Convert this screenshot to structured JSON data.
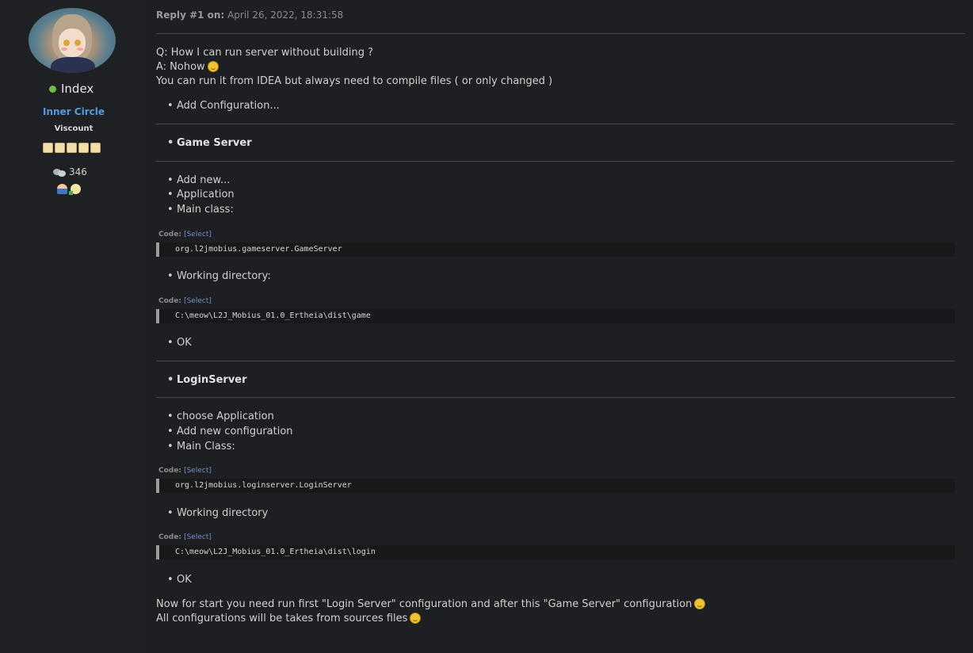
{
  "poster": {
    "username": "Index",
    "group": "Inner Circle",
    "rank": "Viscount",
    "posts": "346",
    "colors": {
      "group": "#4f9de0",
      "online": "#6cbf3f"
    }
  },
  "post": {
    "reply_label": "Reply #1 on:",
    "date": "April 26, 2022, 18:31:58",
    "intro": [
      "Q: How I can run server without building ?",
      "A: Nohow",
      "You can run it from IDEA but always need to compile files ( or only changed )"
    ],
    "add_configuration": "Add Configuration...",
    "game_server_heading": "Game Server",
    "game_steps": [
      "Add new...",
      "Application",
      "Main class:"
    ],
    "code_label": "Code:",
    "select_label": "[Select]",
    "game_main_class": "org.l2jmobius.gameserver.GameServer",
    "working_directory_label": "Working directory:",
    "game_working_dir": "C:\\meow\\L2J_Mobius_01.0_Ertheia\\dist\\game",
    "ok_label": "OK",
    "login_server_heading": "LoginServer",
    "login_steps": [
      "choose Application",
      "Add new configuration",
      "Main Class:"
    ],
    "login_main_class": "org.l2jmobius.loginserver.LoginServer",
    "working_directory_label_2": "Working directory",
    "login_working_dir": "C:\\meow\\L2J_Mobius_01.0_Ertheia\\dist\\login",
    "outro": [
      "Now for start you need run first \"Login Server\" configuration and after this \"Game Server\" configuration",
      "All configurations will be takes from sources files"
    ]
  }
}
